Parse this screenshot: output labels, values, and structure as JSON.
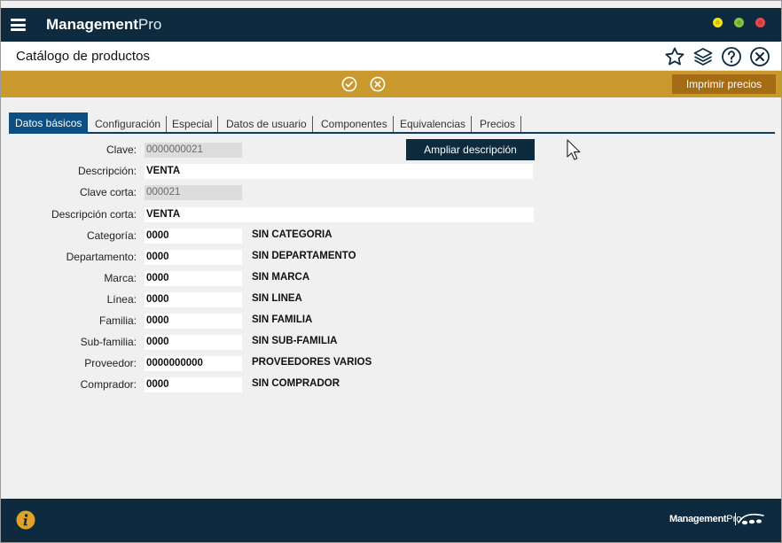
{
  "app": {
    "brand_bold": "Management",
    "brand_light": "Pro",
    "footer_brand_bold": "Management",
    "footer_brand_light": "Pro"
  },
  "header": {
    "title": "Catálogo de productos",
    "icons": [
      "star-icon",
      "layers-icon",
      "help-icon",
      "close-circle-icon"
    ]
  },
  "actionbar": {
    "icons": [
      "check-circle-icon",
      "cancel-circle-icon"
    ],
    "print_label": "Imprimir precios"
  },
  "tabs": [
    {
      "label": "Datos básicos",
      "active": true
    },
    {
      "label": "Configuración",
      "active": false
    },
    {
      "label": "Especial",
      "active": false
    },
    {
      "label": "Datos de usuario",
      "active": false
    },
    {
      "label": "Componentes",
      "active": false
    },
    {
      "label": "Equivalencias",
      "active": false
    },
    {
      "label": "Precios",
      "active": false
    }
  ],
  "ampliar_label": "Ampliar descripción",
  "form": {
    "clave": {
      "label": "Clave:",
      "value": "0000000021"
    },
    "descripcion": {
      "label": "Descripción:",
      "value": "VENTA"
    },
    "clave_corta": {
      "label": "Clave corta:",
      "value": "000021"
    },
    "descripcion_corta": {
      "label": "Descripción corta:",
      "value": "VENTA"
    },
    "rows": [
      {
        "label": "Categoría:",
        "value": "0000",
        "desc": "SIN CATEGORIA"
      },
      {
        "label": "Departamento:",
        "value": "0000",
        "desc": "SIN DEPARTAMENTO"
      },
      {
        "label": "Marca:",
        "value": "0000",
        "desc": "SIN MARCA"
      },
      {
        "label": "Línea:",
        "value": "0000",
        "desc": "SIN LINEA"
      },
      {
        "label": "Familia:",
        "value": "0000",
        "desc": "SIN FAMILIA"
      },
      {
        "label": "Sub-familia:",
        "value": "0000",
        "desc": "SIN SUB-FAMILIA"
      },
      {
        "label": "Proveedor:",
        "value": "0000000000",
        "desc": "PROVEEDORES VARIOS"
      },
      {
        "label": "Comprador:",
        "value": "0000",
        "desc": "SIN COMPRADOR"
      }
    ]
  },
  "colors": {
    "titlebar": "#0d2a3e",
    "actionbar": "#c9992e",
    "print_button": "#a56c15",
    "active_tab": "#0d4f82"
  }
}
